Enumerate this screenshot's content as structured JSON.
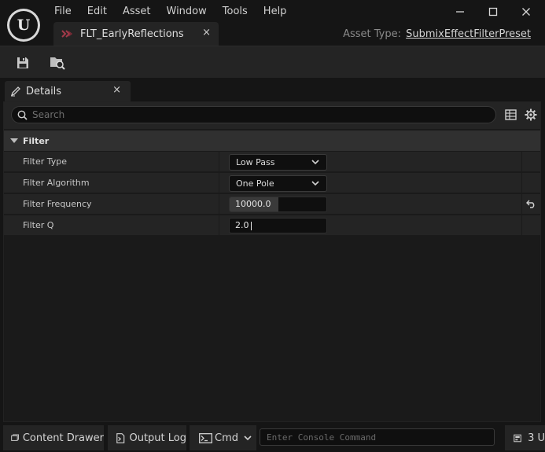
{
  "menu": [
    "File",
    "Edit",
    "Asset",
    "Window",
    "Tools",
    "Help"
  ],
  "asset_tab": {
    "label": "FLT_EarlyReflections",
    "close": "×"
  },
  "asset_type": {
    "label": "Asset Type:",
    "value": "SubmixEffectFilterPreset"
  },
  "details": {
    "tab_label": "Details",
    "close": "×",
    "search_placeholder": "Search",
    "category": "Filter",
    "properties": [
      {
        "name": "Filter Type",
        "value": "Low Pass",
        "kind": "combo"
      },
      {
        "name": "Filter Algorithm",
        "value": "One Pole",
        "kind": "combo"
      },
      {
        "name": "Filter Frequency",
        "value": "10000.0",
        "kind": "number",
        "slider_fraction": 0.5
      },
      {
        "name": "Filter Q",
        "value": "2.0",
        "kind": "number"
      }
    ]
  },
  "statusbar": {
    "content_drawer": "Content Drawer",
    "output_log": "Output Log",
    "cmd": "Cmd",
    "console_placeholder": "Enter Console Command",
    "trailing": "3 U"
  },
  "colors": {
    "accent_asset_icon": "#a33a4a",
    "panel_bg": "#242424",
    "window_bg": "#151515"
  }
}
